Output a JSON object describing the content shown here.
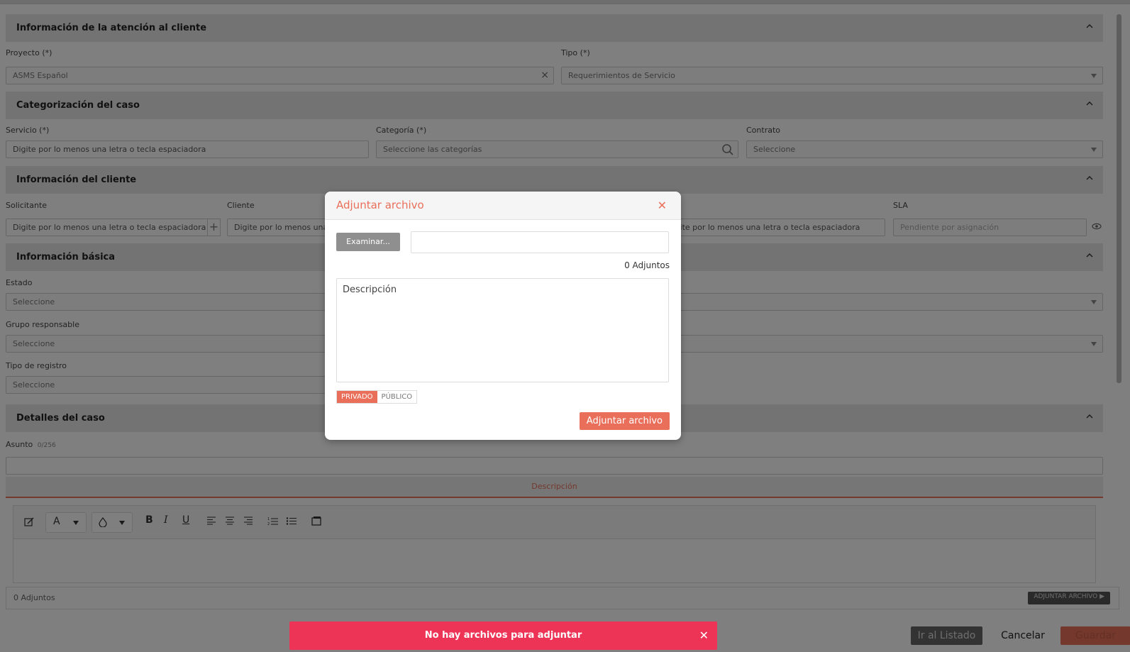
{
  "sections": {
    "customer_attention": {
      "title": "Información de la atención al cliente"
    },
    "case_categorization": {
      "title": "Categorización del caso"
    },
    "client_info": {
      "title": "Información del cliente"
    },
    "basic_info": {
      "title": "Información básica"
    },
    "case_details": {
      "title": "Detalles del caso"
    }
  },
  "fields": {
    "proyecto": {
      "label": "Proyecto (*)",
      "value": "ASMS  Español"
    },
    "tipo": {
      "label": "Tipo (*)",
      "value": "Requerimientos de Servicio"
    },
    "servicio": {
      "label": "Servicio (*)",
      "value": "Digite por lo menos una letra o tecla espaciadora"
    },
    "categoria": {
      "label": "Categoría (*)",
      "value": "Seleccione las categorías"
    },
    "contrato": {
      "label": "Contrato",
      "value": "Seleccione"
    },
    "solicitante": {
      "label": "Solicitante",
      "value": "Digite por lo menos una letra o tecla espaciadora"
    },
    "cliente": {
      "label": "Cliente",
      "value": "Digite por lo menos una letra o tecla espaciadora"
    },
    "third": {
      "value": "Digite por lo menos una letra o tecla espaciadora"
    },
    "sla": {
      "label": "SLA",
      "value": "Pendiente por asignación"
    },
    "estado": {
      "label": "Estado",
      "value": "Seleccione"
    },
    "grupo": {
      "label": "Grupo responsable",
      "value": "Seleccione"
    },
    "tipo_registro": {
      "label": "Tipo de registro",
      "value": "Seleccione"
    },
    "asunto": {
      "label": "Asunto",
      "counter": "0/256",
      "value": ""
    }
  },
  "editor": {
    "tab_label": "Descripción",
    "toolbar": {
      "font": "A",
      "bold": "B",
      "italic": "I",
      "underline": "U"
    }
  },
  "attachments_bar": {
    "count": "0 Adjuntos",
    "button": "ADJUNTAR ARCHIVO"
  },
  "footer": {
    "list_button": "Ir al Listado",
    "cancel_button": "Cancelar",
    "save_button": "Guardar"
  },
  "modal": {
    "title": "Adjuntar archivo",
    "browse_button": "Examinar...",
    "file_value": "",
    "count": "0 Adjuntos",
    "description_placeholder": "Descripción",
    "privacy": {
      "private": "PRIVADO",
      "public": "PÚBLICO",
      "selected": "PRIVADO"
    },
    "submit_button": "Adjuntar archivo"
  },
  "toast": {
    "message": "No hay archivos para adjuntar"
  },
  "colors": {
    "accent": "#ea6f5a",
    "toast": "#ee3456",
    "header_bg": "#e6e6e6"
  }
}
